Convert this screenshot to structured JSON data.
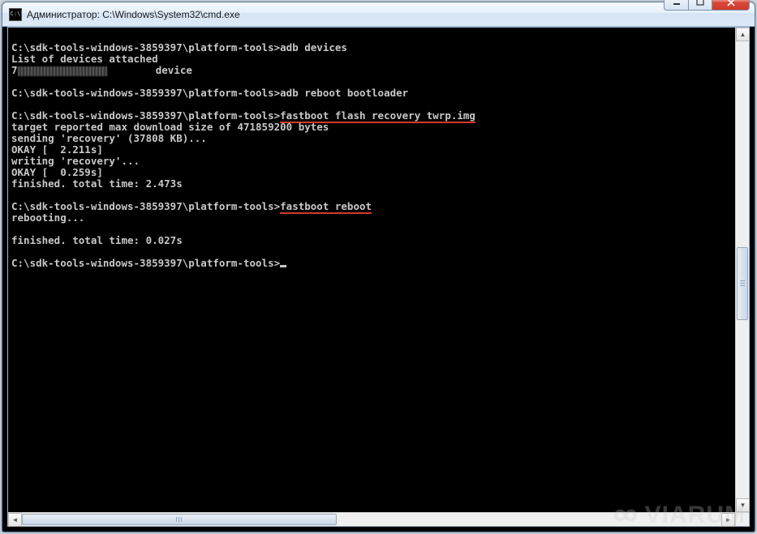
{
  "window": {
    "title": "Администратор: C:\\Windows\\System32\\cmd.exe"
  },
  "buttons": {
    "minimize": "–",
    "maximize": "□",
    "close": "✕"
  },
  "terminal": {
    "prompt": "C:\\sdk-tools-windows-3859397\\platform-tools>",
    "lines": {
      "cmd1": "adb devices",
      "out1a": "List of devices attached",
      "out1b_prefix": "7",
      "out1b_suffix": "        device",
      "cmd2": "adb reboot bootloader",
      "cmd3": "fastboot flash recovery twrp.img",
      "out3a": "target reported max download size of 471859200 bytes",
      "out3b": "sending 'recovery' (37808 KB)...",
      "out3c": "OKAY [  2.211s]",
      "out3d": "writing 'recovery'...",
      "out3e": "OKAY [  0.259s]",
      "out3f": "finished. total time: 2.473s",
      "cmd4": "fastboot reboot",
      "out4a": "rebooting...",
      "out4b": "finished. total time: 0.027s"
    }
  },
  "watermark": {
    "text": "VIARUM"
  }
}
